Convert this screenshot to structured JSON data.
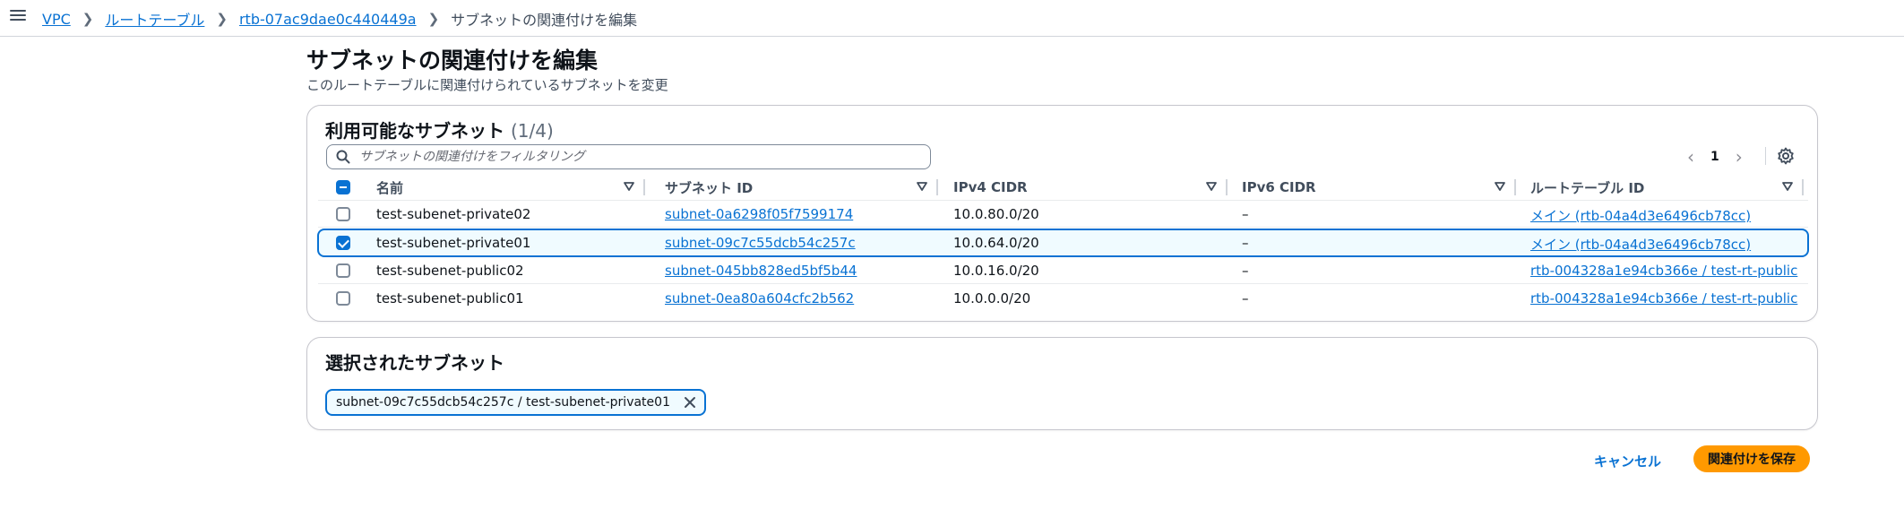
{
  "breadcrumb": {
    "items": [
      "VPC",
      "ルートテーブル",
      "rtb-07ac9dae0c440449a"
    ],
    "current": "サブネットの関連付けを編集"
  },
  "header": {
    "title": "サブネットの関連付けを編集",
    "description": "このルートテーブルに関連付けられているサブネットを変更"
  },
  "available": {
    "title": "利用可能なサブネット",
    "count": "(1/4)",
    "search_placeholder": "サブネットの関連付けをフィルタリング",
    "page": "1",
    "columns": [
      "名前",
      "サブネット ID",
      "IPv4 CIDR",
      "IPv6 CIDR",
      "ルートテーブル ID"
    ],
    "rows": [
      {
        "name": "test-subenet-private02",
        "subnet_id": "subnet-0a6298f05f7599174",
        "ipv4": "10.0.80.0/20",
        "ipv6": "–",
        "route_table": "メイン (rtb-04a4d3e6496cb78cc)",
        "checked": false
      },
      {
        "name": "test-subenet-private01",
        "subnet_id": "subnet-09c7c55dcb54c257c",
        "ipv4": "10.0.64.0/20",
        "ipv6": "–",
        "route_table": "メイン (rtb-04a4d3e6496cb78cc)",
        "checked": true
      },
      {
        "name": "test-subenet-public02",
        "subnet_id": "subnet-045bb828ed5bf5b44",
        "ipv4": "10.0.16.0/20",
        "ipv6": "–",
        "route_table": "rtb-004328a1e94cb366e / test-rt-public",
        "checked": false
      },
      {
        "name": "test-subenet-public01",
        "subnet_id": "subnet-0ea80a604cfc2b562",
        "ipv4": "10.0.0.0/20",
        "ipv6": "–",
        "route_table": "rtb-004328a1e94cb366e / test-rt-public",
        "checked": false
      }
    ]
  },
  "selected": {
    "title": "選択されたサブネット",
    "token": "subnet-09c7c55dcb54c257c / test-subenet-private01"
  },
  "footer": {
    "cancel_label": "キャンセル",
    "save_label": "関連付けを保存"
  },
  "colors": {
    "link": "#0972d3",
    "primary_button": "#ff9900",
    "selected_row_bg": "#f0fbff"
  }
}
